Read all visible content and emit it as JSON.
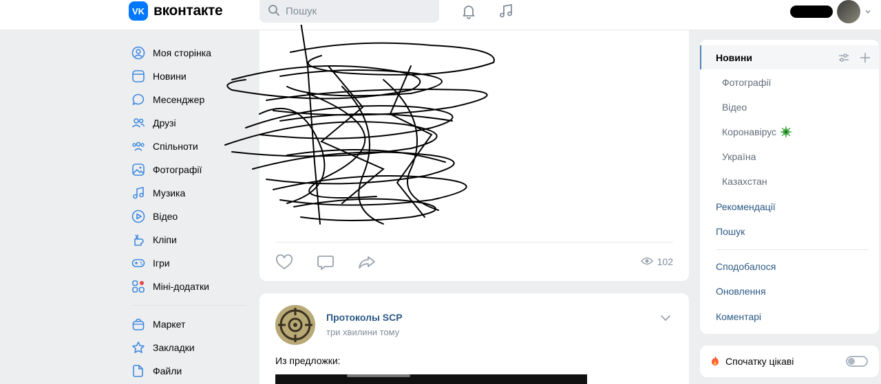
{
  "header": {
    "logo_mark": "VK",
    "logo_text": "вконтакте",
    "search_placeholder": "Пошук",
    "icons": [
      "bell-icon",
      "music-icon",
      "chevron-down-icon"
    ]
  },
  "left_nav": {
    "items": [
      {
        "label": "Моя сторінка",
        "icon": "user-circle-icon"
      },
      {
        "label": "Новини",
        "icon": "newsfeed-icon"
      },
      {
        "label": "Месенджер",
        "icon": "message-icon"
      },
      {
        "label": "Друзі",
        "icon": "friends-icon"
      },
      {
        "label": "Спільноти",
        "icon": "communities-icon"
      },
      {
        "label": "Фотографії",
        "icon": "photo-icon"
      },
      {
        "label": "Музика",
        "icon": "music-icon"
      },
      {
        "label": "Відео",
        "icon": "video-icon"
      },
      {
        "label": "Кліпи",
        "icon": "clips-icon"
      },
      {
        "label": "Ігри",
        "icon": "gamepad-icon"
      },
      {
        "label": "Міні-додатки",
        "icon": "apps-icon"
      }
    ],
    "items2": [
      {
        "label": "Маркет",
        "icon": "bag-icon"
      },
      {
        "label": "Закладки",
        "icon": "star-icon"
      },
      {
        "label": "Файли",
        "icon": "file-icon"
      }
    ]
  },
  "post1": {
    "views": "102",
    "actions": [
      "like-icon",
      "comment-icon",
      "share-icon"
    ]
  },
  "post2": {
    "author": "Протоколы SCP",
    "time": "три хвилини тому",
    "text": "Из предложки:"
  },
  "right_nav": {
    "title": "Новини",
    "sub_items": [
      "Фотографії",
      "Відео",
      "Коронавірус",
      "Україна",
      "Казахстан"
    ],
    "items": [
      "Рекомендації",
      "Пошук"
    ],
    "items2": [
      "Сподобалося",
      "Оновлення",
      "Коментарі"
    ]
  },
  "interesting": {
    "label": "Спочатку цікаві",
    "enabled": false
  },
  "colors": {
    "accent": "#0077ff",
    "link": "#2a5885",
    "background": "#edeef0",
    "muted": "#818c99"
  }
}
